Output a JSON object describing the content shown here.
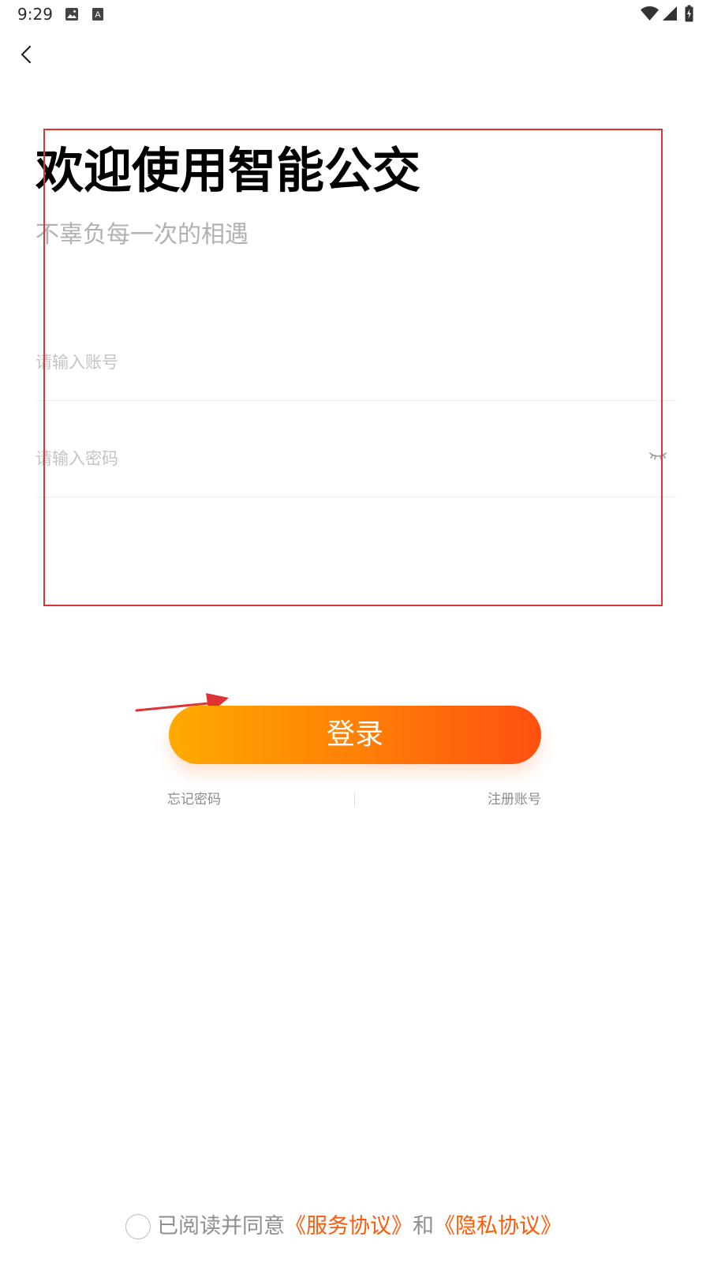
{
  "status_bar": {
    "time": "9:29",
    "left_icons": [
      "image-icon",
      "a-letter-icon"
    ],
    "right_icons": [
      "wifi-icon",
      "signal-icon",
      "battery-charging-icon"
    ]
  },
  "navigation": {
    "back_icon": "chevron-left-icon"
  },
  "header": {
    "title": "欢迎使用智能公交",
    "subtitle": "不辜负每一次的相遇"
  },
  "form": {
    "account_placeholder": "请输入账号",
    "password_placeholder": "请输入密码",
    "account_value": "",
    "password_value": "",
    "password_visibility_icon": "eye-closed-icon"
  },
  "actions": {
    "login_label": "登录",
    "forgot_password_label": "忘记密码",
    "register_label": "注册账号"
  },
  "agreement": {
    "prefix": "已阅读并同意",
    "service_link": "《服务协议》",
    "and": "和",
    "privacy_link": "《隐私协议》",
    "checked": false
  },
  "colors": {
    "background": "#ffffff",
    "title": "#000000",
    "subtitle": "#b1b1b1",
    "placeholder": "#c3c3c8",
    "accent_start": "#ffaa00",
    "accent_end": "#ff4f10",
    "link_orange": "#ff5a0a",
    "annotation_red": "#df3335"
  }
}
